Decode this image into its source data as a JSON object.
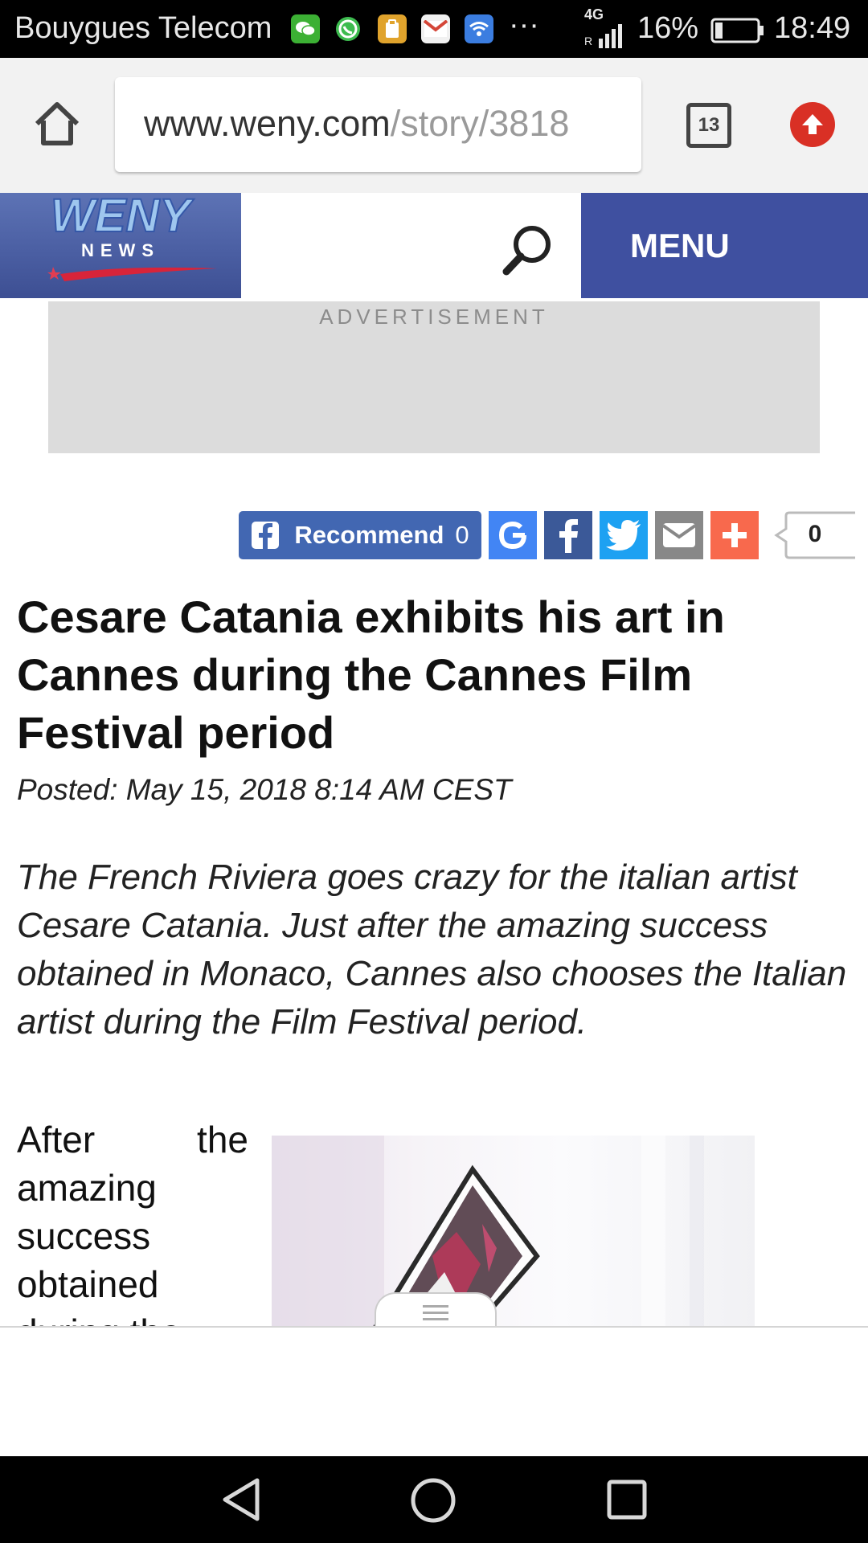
{
  "status_bar": {
    "carrier": "Bouygues Telecom",
    "notification_icons": [
      "wechat-icon",
      "whatsapp-icon",
      "clipboard-icon",
      "gmail-icon",
      "wifi-icon"
    ],
    "more": "···",
    "network": "4G",
    "battery": "16%",
    "time": "18:49"
  },
  "browser": {
    "url_host": "www.weny.com",
    "url_path": "/story/3818",
    "tab_count": "13"
  },
  "site_header": {
    "logo_text": "WENY",
    "logo_sub": "NEWS",
    "menu_label": "MENU"
  },
  "ad": {
    "label": "ADVERTISEMENT"
  },
  "share": {
    "recommend_label": "Recommend",
    "recommend_count": "0",
    "share_count": "0"
  },
  "article": {
    "headline": "Cesare Catania exhibits his art in Cannes during the Cannes Film Festival period",
    "posted": "Posted: May 15, 2018 8:14 AM CEST",
    "lede": "The French Riviera goes crazy for the italian artist Cesare Catania. Just after the amazing success obtained in Monaco, Cannes also chooses the Italian artist during the Film Festival period.",
    "body": "After the amazing success obtained during the"
  },
  "colors": {
    "facebook": "#4267b2",
    "google": "#4285f4",
    "twitter": "#1da1f2",
    "email": "#888888",
    "addthis": "#f8694d",
    "menu_bg": "#3f50a0",
    "upload_red": "#d93025"
  }
}
